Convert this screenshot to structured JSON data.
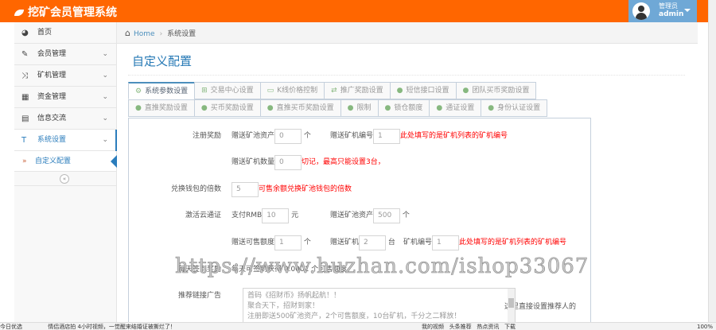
{
  "header": {
    "app_title": "挖矿会员管理系统",
    "user_role": "管理员",
    "user_name": "admin"
  },
  "sidebar": {
    "items": [
      {
        "label": "首页",
        "icon": "dashboard-icon"
      },
      {
        "label": "会员管理",
        "icon": "edit-icon"
      },
      {
        "label": "矿机管理",
        "icon": "random-icon"
      },
      {
        "label": "资金管理",
        "icon": "calendar-icon"
      },
      {
        "label": "信息交流",
        "icon": "list-icon"
      },
      {
        "label": "系统设置",
        "icon": "text-icon"
      }
    ],
    "sub_item": "自定义配置",
    "collapse": "«"
  },
  "breadcrumb": {
    "home": "Home",
    "current": "系统设置"
  },
  "page_title": "自定义配置",
  "tabs_row1": [
    "系统参数设置",
    "交易中心设置",
    "K线价格控制",
    "推广奖励设置",
    "短信接口设置",
    "团队买币奖励设置"
  ],
  "tabs_row2": [
    "直推奖励设置",
    "买币奖励设置",
    "直推买币奖励设置",
    "限制",
    "锁仓额度",
    "通证设置",
    "身份认证设置"
  ],
  "form": {
    "register": {
      "label": "注册奖励",
      "asset_label": "赠送矿池资产",
      "asset_value": "0",
      "asset_unit": "个",
      "machine_no_label": "赠送矿机编号",
      "machine_no_value": "1",
      "machine_no_hint": "此处填写的是矿机列表的矿机编号",
      "machine_count_label": "赠送矿机数量",
      "machine_count_value": "0",
      "machine_count_hint": "切记，最高只能设置3台，"
    },
    "exchange": {
      "label": "兑换钱包的倍数",
      "value": "5",
      "hint": "可售余额兑换矿池钱包的倍数"
    },
    "activate": {
      "label": "激活云通证",
      "pay_label": "支付RMB",
      "pay_value": "10",
      "pay_unit": "元",
      "asset_label": "赠送矿池资产",
      "asset_value": "500",
      "asset_unit": "个",
      "quota_label": "赠送可售额度",
      "quota_value": "1",
      "quota_unit": "个",
      "machine_label": "赠送矿机",
      "machine_value": "2",
      "machine_unit": "台",
      "machine_no_label": "矿机编号",
      "machine_no_value": "1",
      "machine_no_hint": "此处填写的是矿机列表的矿机编号"
    },
    "daily": {
      "label": "每天签到奖励",
      "text": "每天可签到获得 0.0001 个可售额度"
    },
    "ad": {
      "label": "推荐链接广告",
      "lines": [
        "首码《招财币》扬帆起航！！",
        "聚合天下，招财到家！",
        "注册即送500矿池资产，2个可售额度，10台矿机，千分之二释放！"
      ],
      "hint": "这里直接设置推荐人的"
    }
  },
  "watermark": "https://www.huzhan.com/ishop33067",
  "status_bar": {
    "left": "今日优选",
    "news": "情侣酒店拍 4小时视频，一觉醒来结婚证被撕烂了！",
    "items": [
      "我的视频",
      "头条推荐",
      "热点资讯",
      "下载"
    ],
    "zoom": "100%"
  }
}
